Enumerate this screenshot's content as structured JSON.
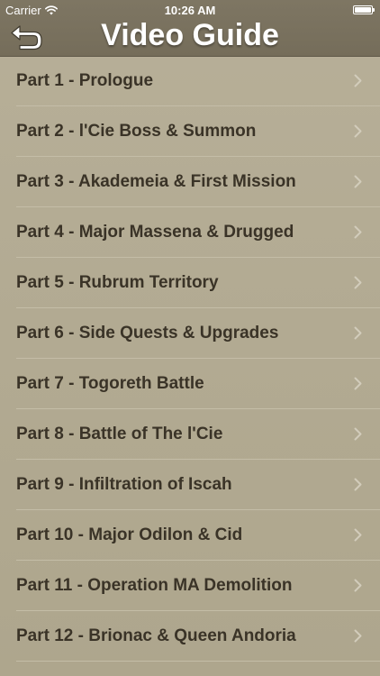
{
  "status_bar": {
    "carrier": "Carrier",
    "time": "10:26 AM"
  },
  "nav": {
    "title": "Video Guide",
    "back_icon": "back-arrow-icon"
  },
  "colors": {
    "nav_background": "#7a7260",
    "list_background": "#b3ab93",
    "text": "#3a3327",
    "separator": "#c4bda7",
    "chevron": "#d2ccbb"
  },
  "items": [
    {
      "label": "Part 1 - Prologue"
    },
    {
      "label": "Part 2 - l'Cie Boss & Summon"
    },
    {
      "label": "Part 3 - Akademeia & First Mission"
    },
    {
      "label": "Part 4 - Major Massena & Drugged"
    },
    {
      "label": "Part 5 - Rubrum Territory"
    },
    {
      "label": "Part 6 - Side Quests & Upgrades"
    },
    {
      "label": "Part 7 - Togoreth Battle"
    },
    {
      "label": "Part 8 - Battle of The l'Cie"
    },
    {
      "label": "Part 9 - Infiltration of Iscah"
    },
    {
      "label": "Part 10 - Major Odilon & Cid"
    },
    {
      "label": "Part 11 - Operation MA Demolition"
    },
    {
      "label": "Part 12 - Brionac & Queen Andoria"
    }
  ]
}
